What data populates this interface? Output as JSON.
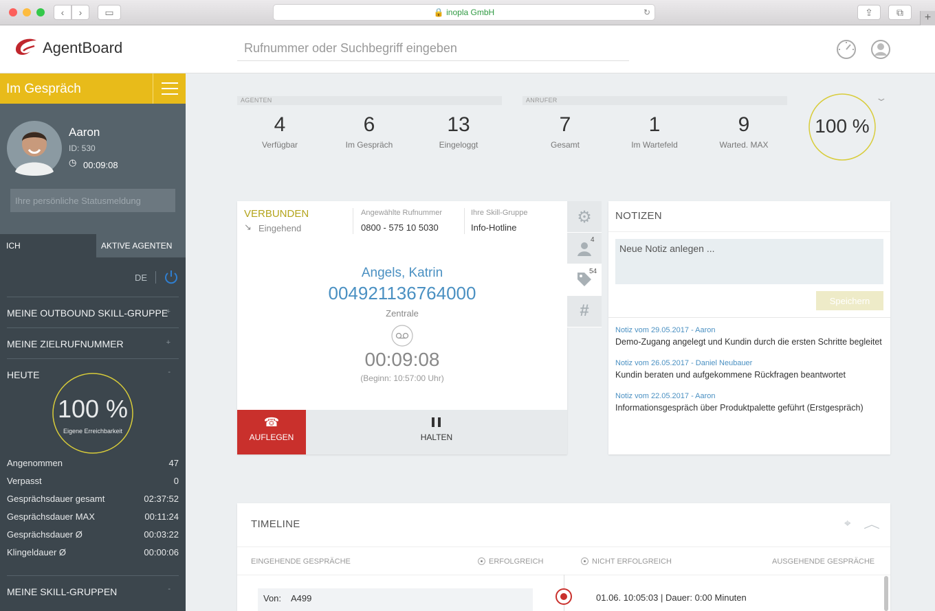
{
  "browser": {
    "url": "inopla GmbH"
  },
  "app": {
    "name": "AgentBoard"
  },
  "search": {
    "placeholder": "Rufnummer oder Suchbegriff eingeben"
  },
  "status": {
    "label": "Im Gespräch"
  },
  "agent": {
    "name": "Aaron",
    "id": "ID: 530",
    "timer": "00:09:08",
    "status_placeholder": "Ihre persönliche Statusmeldung"
  },
  "sidebar": {
    "tab_me": "ICH",
    "tab_active": "AKTIVE AGENTEN",
    "lang": "DE",
    "sec_outbound": "MEINE OUTBOUND SKILL-GRUPPE",
    "sec_target": "MEINE ZIELRUFNUMMER",
    "sec_today": "HEUTE",
    "sec_skills": "MEINE SKILL-GRUPPEN",
    "plus": "+",
    "minus": "-",
    "reach_value": "100 %",
    "reach_label": "Eigene Erreichbarkeit",
    "stats": [
      {
        "label": "Angenommen",
        "value": "47"
      },
      {
        "label": "Verpasst",
        "value": "0"
      },
      {
        "label": "Gesprächsdauer gesamt",
        "value": "02:37:52"
      },
      {
        "label": "Gesprächsdauer MAX",
        "value": "00:11:24"
      },
      {
        "label": "Gesprächsdauer Ø",
        "value": "00:03:22"
      },
      {
        "label": "Klingeldauer Ø",
        "value": "00:00:06"
      }
    ]
  },
  "kpi": {
    "agents_label": "AGENTEN",
    "callers_label": "ANRUFER",
    "agents": [
      {
        "value": "4",
        "label": "Verfügbar"
      },
      {
        "value": "6",
        "label": "Im Gespräch"
      },
      {
        "value": "13",
        "label": "Eingeloggt"
      }
    ],
    "callers": [
      {
        "value": "7",
        "label": "Gesamt"
      },
      {
        "value": "1",
        "label": "Im Wartefeld"
      },
      {
        "value": "9",
        "label": "Warted. MAX"
      }
    ],
    "percent": "100 %"
  },
  "call": {
    "state": "VERBUNDEN",
    "direction": "Eingehend",
    "dialed_label": "Angewählte Rufnummer",
    "dialed": "0800 - 575 10 5030",
    "skill_label": "Ihre Skill-Gruppe",
    "skill": "Info-Hotline",
    "caller_name": "Angels, Katrin",
    "caller_number": "004921136764000",
    "caller_location": "Zentrale",
    "duration": "00:09:08",
    "start": "(Beginn: 10:57:00 Uhr)",
    "hangup": "AUFLEGEN",
    "hold": "HALTEN",
    "badge_contacts": "4",
    "badge_tags": "54",
    "hash": "#"
  },
  "notes": {
    "title": "NOTIZEN",
    "placeholder": "Neue Notiz anlegen ...",
    "save": "Speichern",
    "entries": [
      {
        "meta": "Notiz vom 29.05.2017 - Aaron",
        "text": "Demo-Zugang angelegt und Kundin durch die ersten Schritte begleitet"
      },
      {
        "meta": "Notiz vom 26.05.2017 - Daniel Neubauer",
        "text": "Kundin beraten und aufgekommene Rückfragen beantwortet"
      },
      {
        "meta": "Notiz vom 22.05.2017 - Aaron",
        "text": "Informationsgespräch über Produktpalette geführt (Erstgespräch)"
      }
    ]
  },
  "timeline": {
    "title": "TIMELINE",
    "incoming": "EINGEHENDE GESPRÄCHE",
    "success": "ERFOLGREICH",
    "fail": "NICHT ERFOLGREICH",
    "outgoing": "AUSGEHENDE GESPRÄCHE",
    "entry_from_label": "Von:",
    "entry_from": "A499",
    "entry_info": "01.06. 10:05:03 | Dauer: 0:00 Minuten"
  },
  "colors": {
    "accent": "#e8bb1a",
    "danger": "#c9302c",
    "link": "#4a90c2",
    "sidebar": "#3c464d"
  }
}
